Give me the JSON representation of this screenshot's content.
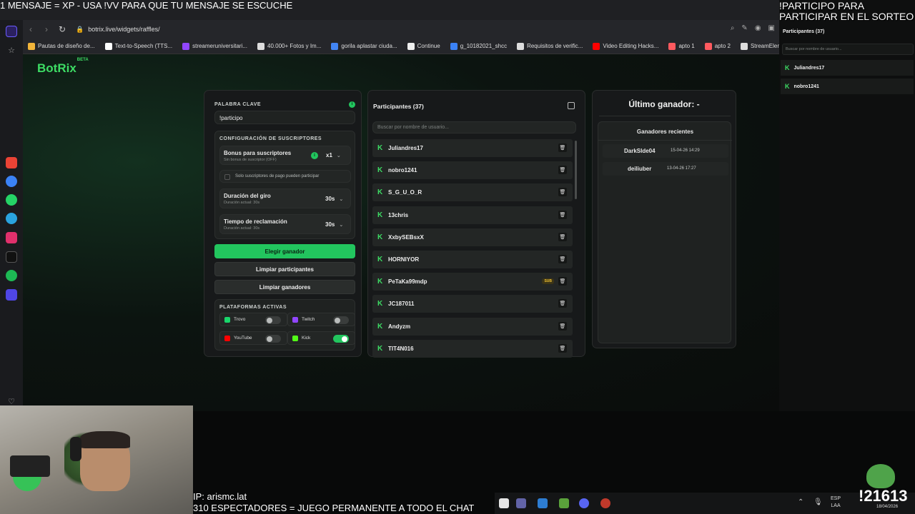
{
  "overlay": {
    "top_left": "1 MENSAJE = XP - USA !VV PARA QUE TU MENSAJE SE ESCUCHE",
    "top_right_line1": "!PARTICIPO PARA",
    "top_right_line2": "PARTICIPAR EN EL SORTEO",
    "bottom_line1": "IP: arismc.lat",
    "bottom_line2": "310 ESPECTADORES = JUEGO PERMANENTE A TODO EL CHAT",
    "counter": "!21613"
  },
  "browser": {
    "url": "botrix.live/widgets/raffles/",
    "bookmarks": [
      {
        "label": "Pautas de diseño de...",
        "color": "#f2b53a"
      },
      {
        "label": "Text-to-Speech (TTS...",
        "color": "#ffffff"
      },
      {
        "label": "streameruniversitari...",
        "color": "#9146ff"
      },
      {
        "label": "40.000+ Fotos y Im...",
        "color": "#dddddd"
      },
      {
        "label": "gorila aplastar ciuda...",
        "color": "#4285f4"
      },
      {
        "label": "Continue",
        "color": "#eeeeee"
      },
      {
        "label": "g_10182021_shcc",
        "color": "#3b82f6"
      },
      {
        "label": "Requisitos de verific...",
        "color": "#dddddd"
      },
      {
        "label": "Video Editing Hacks...",
        "color": "#ff0000"
      },
      {
        "label": "apto 1",
        "color": "#ff5a5f"
      },
      {
        "label": "apto 2",
        "color": "#ff5a5f"
      },
      {
        "label": "StreamElements - st...",
        "color": "#dddddd"
      }
    ]
  },
  "app": {
    "logo": "BotRix",
    "logo_badge": "BETA",
    "keyword_label": "PALABRA CLAVE",
    "keyword_value": "!participo",
    "subs_config_label": "CONFIGURACIÓN DE SUSCRIPTORES",
    "bonus_title": "Bonus para suscriptores",
    "bonus_sub": "Sin bonus de suscriptor (OFF)",
    "bonus_value": "x1",
    "paid_only_label": "Solo suscriptores de pago pueden participar",
    "spin_title": "Duración del giro",
    "spin_sub": "Duración actual: 30s",
    "spin_value": "30s",
    "claim_title": "Tiempo de reclamación",
    "claim_sub": "Duración actual: 30s",
    "claim_value": "30s",
    "choose_winner": "Elegir ganador",
    "clear_participants": "Limpiar participantes",
    "clear_winners": "Limpiar ganadores",
    "platforms_label": "PLATAFORMAS ACTIVAS",
    "platforms": [
      {
        "name": "Trovo",
        "enabled": false,
        "color": "#19d66b"
      },
      {
        "name": "Twitch",
        "enabled": false,
        "color": "#9146ff"
      },
      {
        "name": "YouTube",
        "enabled": false,
        "color": "#ff0000"
      },
      {
        "name": "Kick",
        "enabled": true,
        "color": "#53fc18"
      }
    ]
  },
  "participants": {
    "title": "Participantes (37)",
    "search_placeholder": "Buscar por nombre de usuario...",
    "sub_badge": "SUB",
    "list": [
      "Juliandres17",
      "nobro1241",
      "S_G_U_O_R",
      "13chris",
      "XxbySEBsxX",
      "HORNIYOR",
      "PeTaKa99mdp",
      "JC187011",
      "Andyzm",
      "TIT4N016"
    ]
  },
  "winners": {
    "last_winner": "Último ganador: -",
    "recent_label": "Ganadores recientes",
    "list": [
      {
        "name": "DarkSIde04",
        "date": "15-04-26 14:29"
      },
      {
        "name": "deiliuber",
        "date": "13-04-26 17:27"
      }
    ]
  },
  "mini_widget": {
    "title": "Participantes (37)",
    "search_placeholder": "Buscar por nombre de usuario...",
    "list": [
      "Juliandres17",
      "nobro1241"
    ]
  },
  "taskbar": {
    "lang_line1": "ESP",
    "lang_line2": "LAA",
    "date": "18/04/2026"
  }
}
